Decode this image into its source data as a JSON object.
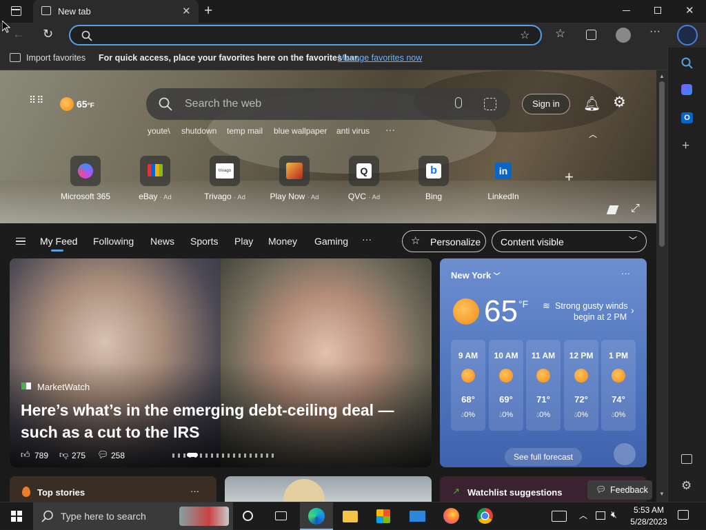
{
  "tab": {
    "title": "New tab"
  },
  "favbar": {
    "import_label": "Import favorites",
    "message": "For quick access, place your favorites here on the favorites bar.",
    "manage_link": "Manage favorites now"
  },
  "hero": {
    "temperature": "65",
    "temp_unit": "°F",
    "search_placeholder": "Search the web",
    "sign_in": "Sign in",
    "trending": [
      "youte\\",
      "shutdown",
      "temp mail",
      "blue wallpaper",
      "anti virus"
    ],
    "more": "···"
  },
  "tiles": [
    {
      "name": "Microsoft 365",
      "ad": ""
    },
    {
      "name": "eBay",
      "ad": "· Ad"
    },
    {
      "name": "Trivago",
      "ad": "· Ad"
    },
    {
      "name": "Play Now",
      "ad": "· Ad"
    },
    {
      "name": "QVC",
      "ad": "· Ad"
    },
    {
      "name": "Bing",
      "ad": ""
    },
    {
      "name": "LinkedIn",
      "ad": ""
    }
  ],
  "feed_nav": {
    "items": [
      "My Feed",
      "Following",
      "News",
      "Sports",
      "Play",
      "Money",
      "Gaming"
    ],
    "more": "···",
    "personalize": "Personalize",
    "content_visible": "Content visible"
  },
  "main_story": {
    "source": "MarketWatch",
    "headline_line1": "Here’s what’s in the emerging debt-ceiling deal —",
    "headline_line2": "such as a cut to the IRS",
    "likes": "789",
    "dislikes": "275",
    "comments": "258"
  },
  "weather": {
    "location": "New York",
    "temp": "65",
    "unit": "°F",
    "alert_line1": "Strong gusty winds",
    "alert_line2": "begin at 2 PM",
    "more": "···",
    "hours": [
      {
        "time": "9 AM",
        "temp": "68°",
        "precip": "0%"
      },
      {
        "time": "10 AM",
        "temp": "69°",
        "precip": "0%"
      },
      {
        "time": "11 AM",
        "temp": "71°",
        "precip": "0%"
      },
      {
        "time": "12 PM",
        "temp": "72°",
        "precip": "0%"
      },
      {
        "time": "1 PM",
        "temp": "74°",
        "precip": "0%"
      }
    ],
    "forecast_button": "See full forecast"
  },
  "bottom": {
    "top_stories": "Top stories",
    "more": "···",
    "watchlist": "Watchlist suggestions",
    "feedback": "Feedback"
  },
  "taskbar": {
    "search_placeholder": "Type here to search",
    "time": "5:53 AM",
    "date": "5/28/2023"
  },
  "colors": {
    "accent": "#5aa0e0",
    "link": "#6cb4ff",
    "weather_bg": "#5a7ec6"
  }
}
